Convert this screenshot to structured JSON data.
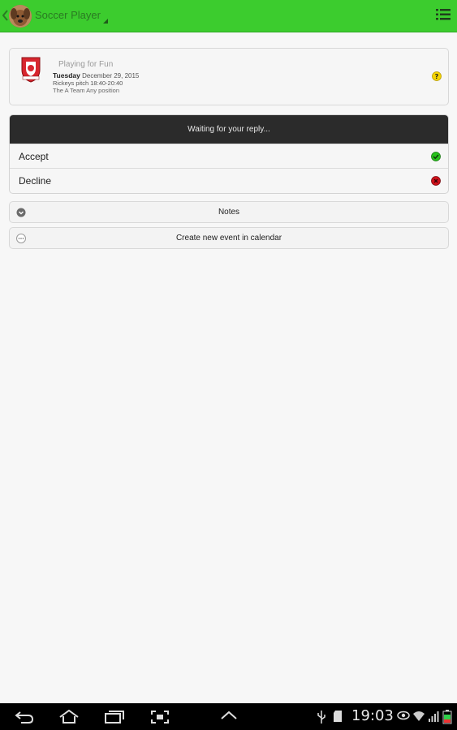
{
  "app": {
    "title": "Soccer Player",
    "theme_color": "#3ccc2e"
  },
  "event": {
    "category": "Playing for Fun",
    "day": "Tuesday",
    "date": "December 29, 2015",
    "location_time": "Rickeys pitch 18:40-20:40",
    "team_position": "The A Team Any position",
    "status_icon": "question-icon"
  },
  "reply": {
    "header": "Waiting for your reply...",
    "options": [
      {
        "label": "Accept",
        "icon": "check-circle-icon",
        "color": "#27c21b"
      },
      {
        "label": "Decline",
        "icon": "cross-circle-icon",
        "color": "#d0121b"
      }
    ]
  },
  "actions": {
    "notes": "Notes",
    "calendar": "Create new event in calendar"
  },
  "status_bar": {
    "time": "19:03"
  }
}
